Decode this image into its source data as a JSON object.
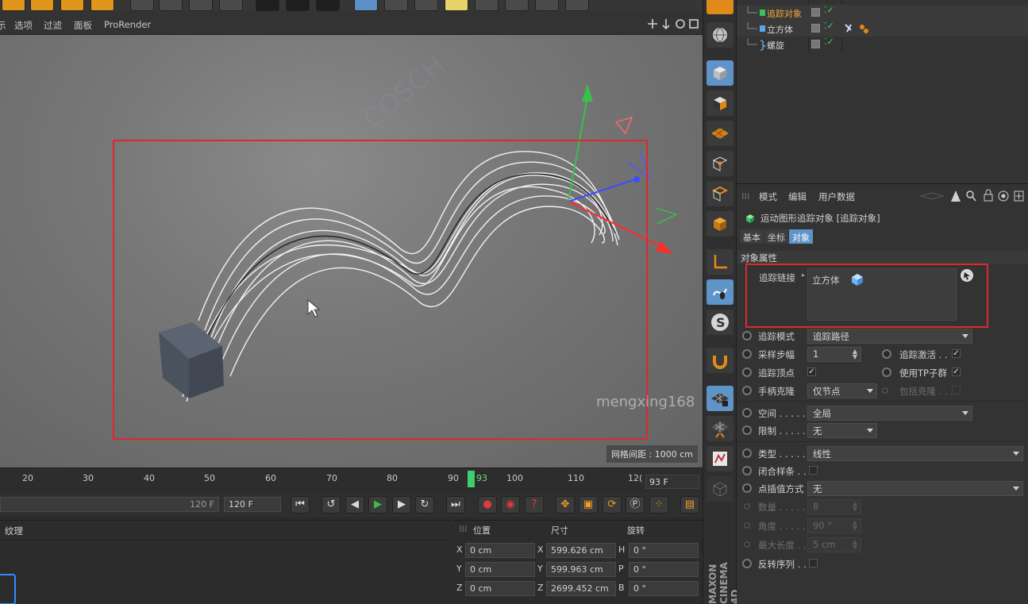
{
  "viewport_menu": [
    "示",
    "选项",
    "过滤",
    "面板",
    "ProRender"
  ],
  "viewport": {
    "grid_spacing": "网格间距 : 1000 cm",
    "watermark": "mengxing168"
  },
  "timeline": {
    "ticks": [
      "20",
      "30",
      "40",
      "50",
      "60",
      "70",
      "80",
      "90",
      "100",
      "110",
      "12("
    ],
    "current_frame_label": "93",
    "current_frame_field": "93 F"
  },
  "transport": {
    "end_frame_slider": "120 F",
    "end_frame_field": "120 F"
  },
  "material_panel": {
    "tab_label": "纹理"
  },
  "coordinates": {
    "headers": {
      "position": "位置",
      "size": "尺寸",
      "rotation": "旋转"
    },
    "rows": [
      {
        "axis": "X",
        "pos": "0 cm",
        "size_axis": "X",
        "size": "599.626 cm",
        "rot_axis": "H",
        "rot": "0 °"
      },
      {
        "axis": "Y",
        "pos": "0 cm",
        "size_axis": "Y",
        "size": "599.963 cm",
        "rot_axis": "P",
        "rot": "0 °"
      },
      {
        "axis": "Z",
        "pos": "0 cm",
        "size_axis": "Z",
        "size": "2699.452 cm",
        "rot_axis": "B",
        "rot": "0 °"
      }
    ]
  },
  "branding": {
    "maxon": "MAXON CINEMA 4D"
  },
  "object_manager": {
    "objects": [
      {
        "name": "追踪对象",
        "selected": true
      },
      {
        "name": "立方体",
        "selected": false
      },
      {
        "name": "螺旋",
        "selected": false
      }
    ]
  },
  "attribute_manager": {
    "menu": [
      "模式",
      "编辑",
      "用户数据"
    ],
    "object_title": "运动图形追踪对象 [追踪对象]",
    "tabs": [
      "基本",
      "坐标",
      "对象"
    ],
    "active_tab": "对象",
    "section": "对象属性",
    "trace_link_label": "追踪链接",
    "trace_link_item": "立方体",
    "props": {
      "trace_mode": {
        "label": "追踪模式",
        "value": "追踪路径"
      },
      "sample_step": {
        "label": "采样步幅",
        "value": "1"
      },
      "trace_active": {
        "label": "追踪激活 . .",
        "checked": "✓"
      },
      "trace_vertices": {
        "label": "追踪顶点",
        "checked": "✓"
      },
      "use_tp": {
        "label": "使用TP子群",
        "checked": "✓"
      },
      "handle_clone": {
        "label": "手柄克隆",
        "value": "仅节点"
      },
      "include_clone": {
        "label": "包括克隆 . . ."
      },
      "space": {
        "label": "空间 . . . . .",
        "value": "全局"
      },
      "limit": {
        "label": "限制 . . . . .",
        "value": "无"
      },
      "type": {
        "label": "类型 . . . . . .",
        "value": "线性"
      },
      "closed": {
        "label": "闭合样条 . ."
      },
      "interp": {
        "label": "点插值方式",
        "value": "无"
      },
      "count": {
        "label": "数量 . . . . . .",
        "value": "8"
      },
      "angle": {
        "label": "角度 . . . . . .",
        "value": "90 °"
      },
      "max_len": {
        "label": "最大长度 . . .",
        "value": "5 cm"
      },
      "reverse": {
        "label": "反转序列 . ."
      }
    }
  },
  "colors": {
    "accent_blue": "#5f94c8",
    "highlight_red": "#e0282c",
    "selected_orange": "#f2a83a",
    "playhead_green": "#3fcf6a"
  }
}
